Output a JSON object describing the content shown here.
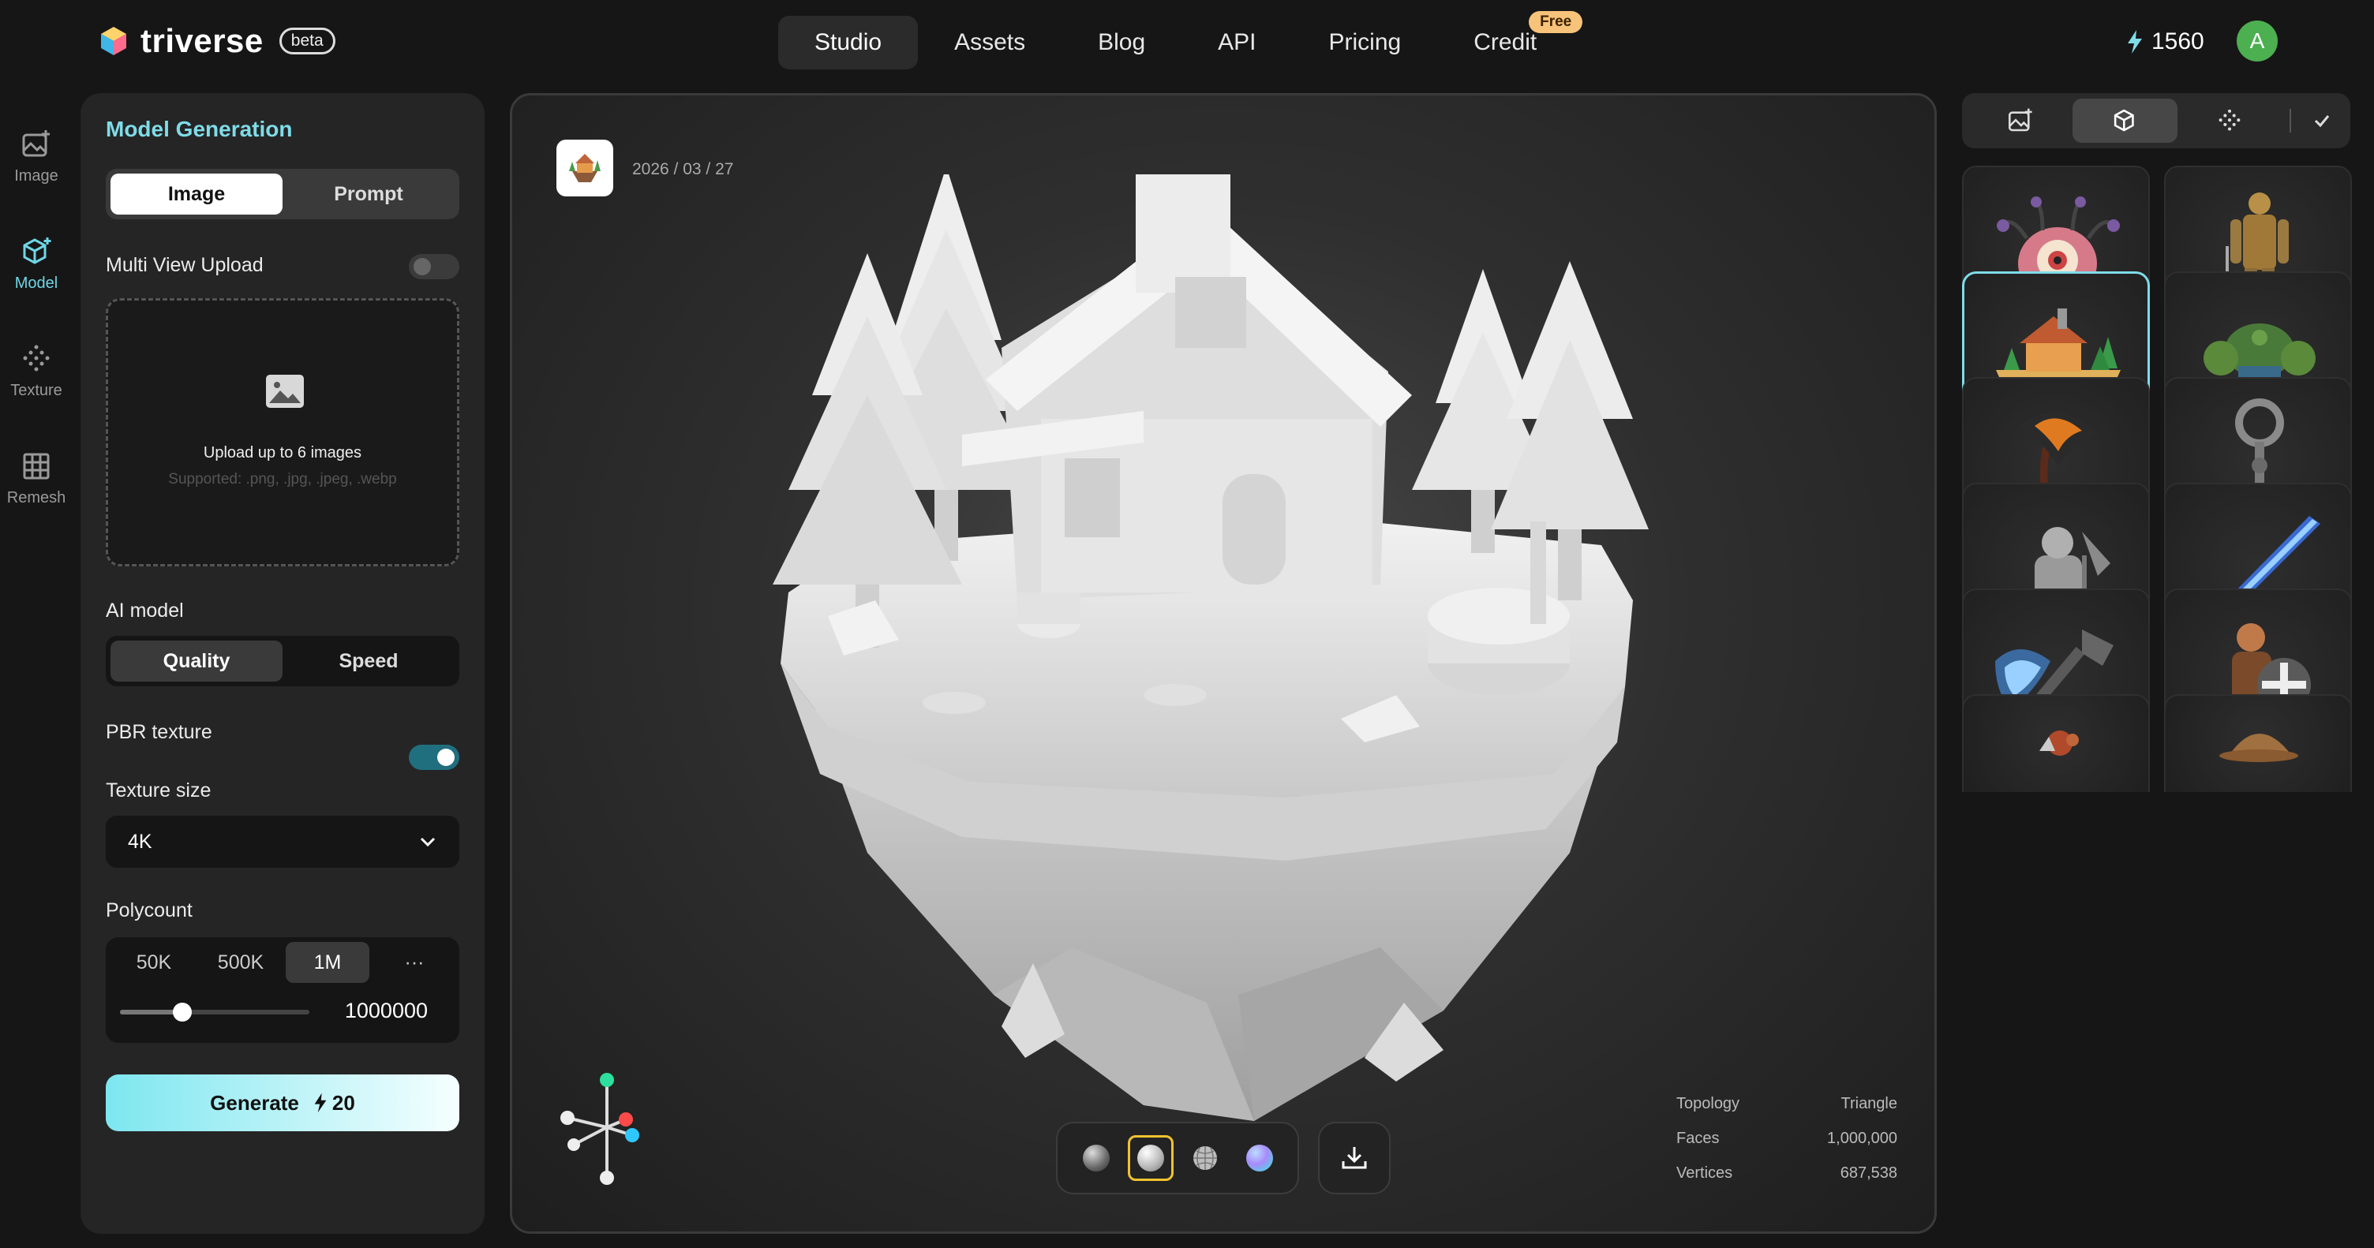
{
  "header": {
    "brand": "triverse",
    "badge": "beta",
    "nav": [
      {
        "label": "Studio",
        "active": true
      },
      {
        "label": "Assets"
      },
      {
        "label": "Blog"
      },
      {
        "label": "API"
      },
      {
        "label": "Pricing"
      },
      {
        "label": "Credit",
        "badge": "Free"
      }
    ],
    "credits": "1560",
    "avatar_initial": "A"
  },
  "rail": [
    {
      "label": "Image",
      "icon": "image-plus-icon"
    },
    {
      "label": "Model",
      "icon": "cube-plus-icon",
      "active": true
    },
    {
      "label": "Texture",
      "icon": "dots-grid-icon"
    },
    {
      "label": "Remesh",
      "icon": "grid-icon"
    }
  ],
  "panel": {
    "title": "Model Generation",
    "tabs": [
      "Image",
      "Prompt"
    ],
    "multi_view_label": "Multi View Upload",
    "multi_view_on": false,
    "upload_title": "Upload up to 6 images",
    "upload_hint": "Supported: .png, .jpg, .jpeg, .webp",
    "ai_model_label": "AI model",
    "ai_model_options": [
      "Quality",
      "Speed"
    ],
    "ai_model_selected": "Quality",
    "pbr_label": "PBR texture",
    "pbr_on": true,
    "texture_size_label": "Texture size",
    "texture_size_value": "4K",
    "polycount_label": "Polycount",
    "polycount_options": [
      "50K",
      "500K",
      "1M"
    ],
    "polycount_more": "···",
    "polycount_selected": "1M",
    "polycount_value": "1000000",
    "polycount_slider_fraction": 0.33,
    "generate_label": "Generate",
    "generate_cost": "20"
  },
  "viewport": {
    "date": "2026 / 03 / 27",
    "stats": [
      {
        "label": "Topology",
        "value": "Triangle"
      },
      {
        "label": "Faces",
        "value": "1,000,000"
      },
      {
        "label": "Vertices",
        "value": "687,538"
      }
    ],
    "materials": [
      "matte-sphere-icon",
      "clay-sphere-icon",
      "wireframe-sphere-icon",
      "normal-sphere-icon"
    ],
    "selected_material_index": 1
  },
  "gallery": {
    "tabs": [
      "image-plus-icon",
      "cube-icon",
      "dots-grid-icon",
      "check-icon"
    ],
    "active_tab_index": 1,
    "items": [
      "beholder-model",
      "armored-knight-model",
      "floating-island-house-model",
      "green-golem-model",
      "fire-axe-model",
      "ornate-key-model",
      "dwarf-warrior-model",
      "crystal-sword-model",
      "ice-battle-axe-model",
      "crusader-dwarf-model",
      "creature-model",
      "hat-model"
    ],
    "selected_index": 2
  },
  "colors": {
    "accent": "#7fdce8",
    "toggle_on": "#1f6f7f",
    "material_selected": "#f2c230",
    "avatar": "#4caf50",
    "free_badge": "#f7c27a"
  }
}
